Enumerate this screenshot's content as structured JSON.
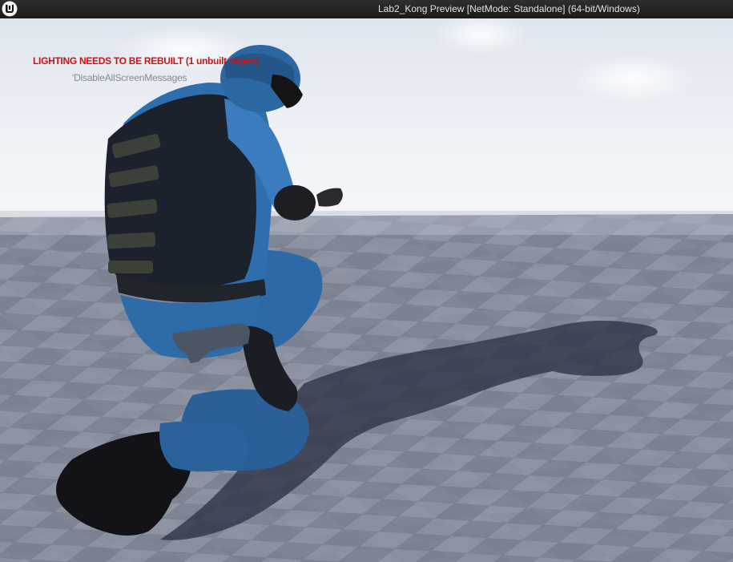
{
  "window": {
    "title": "Lab2_Kong Preview [NetMode: Standalone]  (64-bit/Windows)",
    "logo_icon": "unreal-engine-logo-icon"
  },
  "viewport": {
    "messages": {
      "lighting_warning": "LIGHTING NEEDS TO BE REBUILT (1 unbuilt object)",
      "disable_hint": "'DisableAllScreenMessages"
    },
    "colors": {
      "warning_text": "#c81414",
      "hint_text": "#8a8a8a",
      "sky": "#eef1f6",
      "floor_light": "#8f96a6",
      "floor_dark": "#5d6270",
      "uniform_blue": "#2c6aa8",
      "vest": "#1c2230"
    },
    "scene": {
      "character": "kneeling swat character",
      "icons": [
        "pistol-icon",
        "holster-icon"
      ]
    }
  }
}
